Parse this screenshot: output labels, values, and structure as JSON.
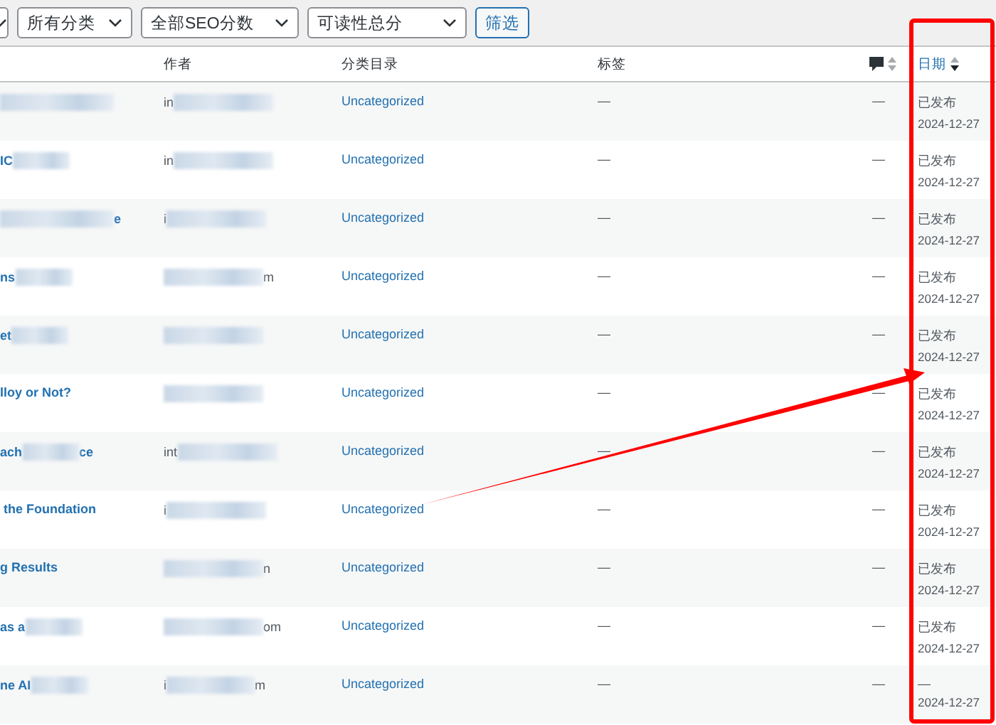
{
  "filters": {
    "selects": [
      {
        "label": "所有分类"
      },
      {
        "label": "全部SEO分数"
      },
      {
        "label": "可读性总分"
      }
    ],
    "button": "筛选"
  },
  "table": {
    "columns": [
      {
        "kind": "text",
        "label": "作者",
        "sortable": false
      },
      {
        "kind": "text",
        "label": "分类目录",
        "sortable": false
      },
      {
        "kind": "text",
        "label": "标签",
        "sortable": false
      },
      {
        "kind": "icon",
        "sortable": true,
        "sorted": false
      },
      {
        "kind": "text",
        "label": "日期",
        "sortable": true,
        "sorted": true
      }
    ],
    "rows": [
      {
        "title_blurred": true,
        "author_prefix": "in",
        "category": "Uncategorized",
        "tags": "—",
        "comments": "—",
        "status": "已发布",
        "date": "2024-12-27"
      },
      {
        "title_prefix": "IC",
        "title_blurred": true,
        "author_prefix": "in",
        "category": "Uncategorized",
        "tags": "—",
        "comments": "—",
        "status": "已发布",
        "date": "2024-12-27"
      },
      {
        "title_blurred": true,
        "title_suffix": "e",
        "author_prefix": "i",
        "category": "Uncategorized",
        "tags": "—",
        "comments": "—",
        "status": "已发布",
        "date": "2024-12-27"
      },
      {
        "title_prefix": "ns",
        "title_blurred": true,
        "author_suffix": "m",
        "category": "Uncategorized",
        "tags": "—",
        "comments": "—",
        "status": "已发布",
        "date": "2024-12-27"
      },
      {
        "title_prefix": "et",
        "title_blurred": true,
        "category": "Uncategorized",
        "tags": "—",
        "comments": "—",
        "status": "已发布",
        "date": "2024-12-27"
      },
      {
        "title_prefix": "lloy or Not?",
        "title_blurred": false,
        "category": "Uncategorized",
        "tags": "—",
        "comments": "—",
        "status": "已发布",
        "date": "2024-12-27"
      },
      {
        "title_prefix": "ach",
        "title_blurred": true,
        "title_suffix": "ce",
        "author_prefix": "int",
        "category": "Uncategorized",
        "tags": "—",
        "comments": "—",
        "status": "已发布",
        "date": "2024-12-27"
      },
      {
        "title_prefix": " the Foundation",
        "title_blurred": false,
        "author_prefix": "i",
        "category": "Uncategorized",
        "tags": "—",
        "comments": "—",
        "status": "已发布",
        "date": "2024-12-27"
      },
      {
        "title_prefix": "g Results",
        "title_blurred": false,
        "author_suffix": "n",
        "category": "Uncategorized",
        "tags": "—",
        "comments": "—",
        "status": "已发布",
        "date": "2024-12-27"
      },
      {
        "title_prefix": "as a",
        "title_blurred": true,
        "author_suffix": "om",
        "category": "Uncategorized",
        "tags": "—",
        "comments": "—",
        "status": "已发布",
        "date": "2024-12-27"
      },
      {
        "title_prefix": "ne AI",
        "title_blurred": true,
        "author_prefix": "i",
        "author_suffix": "m",
        "category": "Uncategorized",
        "tags": "—",
        "comments": "—",
        "status": "—",
        "date": "2024-12-27"
      }
    ]
  },
  "annotation": {
    "kind": "highlight-arrow"
  }
}
